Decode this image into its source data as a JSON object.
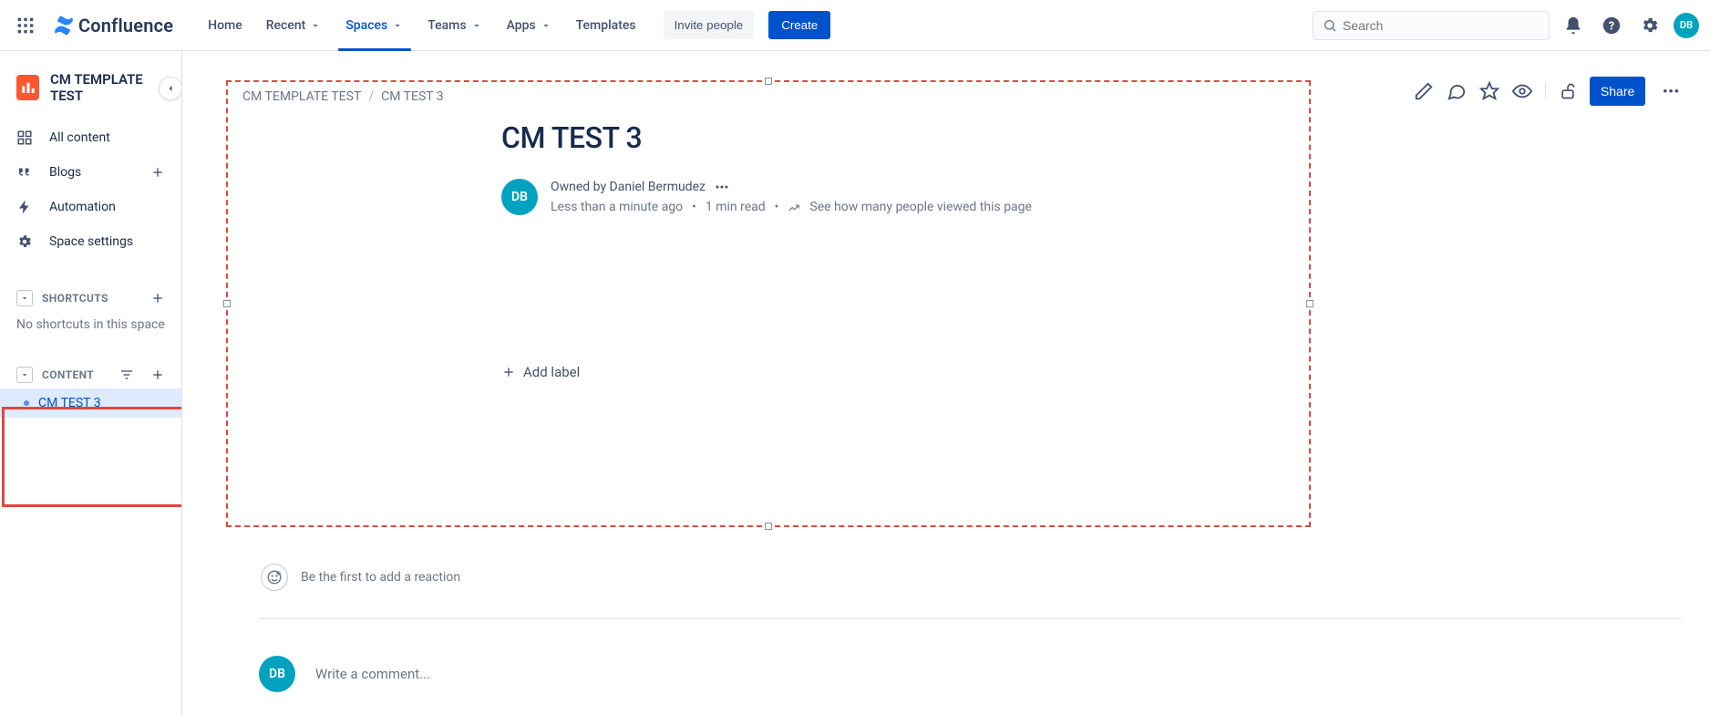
{
  "brand": "Confluence",
  "nav": {
    "home": "Home",
    "recent": "Recent",
    "spaces": "Spaces",
    "teams": "Teams",
    "apps": "Apps",
    "templates": "Templates",
    "invite": "Invite people",
    "create": "Create"
  },
  "search_placeholder": "Search",
  "avatar_initials": "DB",
  "sidebar": {
    "space_name": "CM TEMPLATE TEST",
    "all_content": "All content",
    "blogs": "Blogs",
    "automation": "Automation",
    "space_settings": "Space settings",
    "shortcuts_header": "SHORTCUTS",
    "shortcuts_empty": "No shortcuts in this space",
    "content_header": "CONTENT",
    "items": [
      {
        "title": "CM TEST 3",
        "selected": true
      }
    ]
  },
  "page": {
    "breadcrumb_space": "CM TEMPLATE TEST",
    "breadcrumb_page": "CM TEST 3",
    "title": "CM TEST 3",
    "owned_by": "Owned by Daniel Bermudez",
    "age": "Less than a minute ago",
    "read_time": "1 min read",
    "views_text": "See how many people viewed this page",
    "add_label": "Add label",
    "share": "Share",
    "reaction_prompt": "Be the first to add a reaction",
    "comment_placeholder": "Write a comment..."
  }
}
